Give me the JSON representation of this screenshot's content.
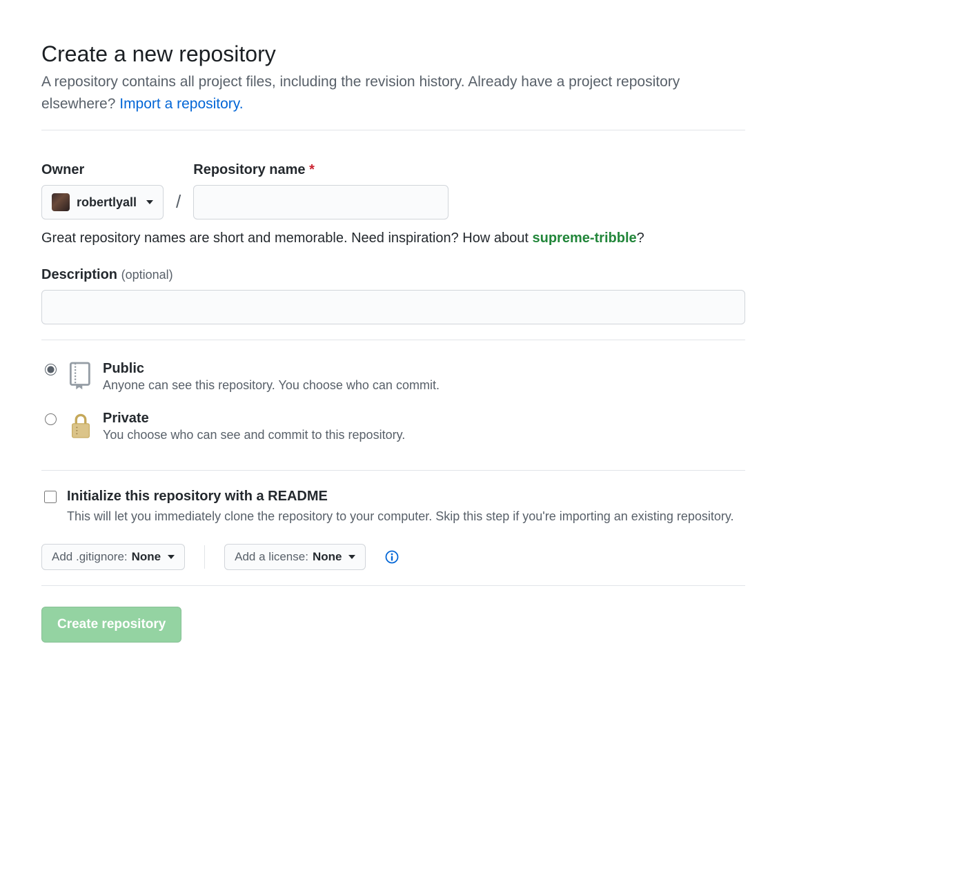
{
  "header": {
    "title": "Create a new repository",
    "subhead_text": "A repository contains all project files, including the revision history. Already have a project repository elsewhere? ",
    "import_link": "Import a repository."
  },
  "owner": {
    "label": "Owner",
    "selected": "robertlyall"
  },
  "repo_name": {
    "label": "Repository name",
    "required_marker": "*",
    "value": ""
  },
  "naming_tip": {
    "prefix": "Great repository names are short and memorable. Need inspiration? How about ",
    "suggestion": "supreme-tribble",
    "suffix": "?"
  },
  "description": {
    "label": "Description",
    "optional": "(optional)",
    "value": ""
  },
  "visibility": {
    "public": {
      "title": "Public",
      "desc": "Anyone can see this repository. You choose who can commit.",
      "checked": true
    },
    "private": {
      "title": "Private",
      "desc": "You choose who can see and commit to this repository.",
      "checked": false
    }
  },
  "init_readme": {
    "title": "Initialize this repository with a README",
    "desc": "This will let you immediately clone the repository to your computer. Skip this step if you're importing an existing repository.",
    "checked": false
  },
  "gitignore": {
    "label_prefix": "Add .gitignore: ",
    "value": "None"
  },
  "license": {
    "label_prefix": "Add a license: ",
    "value": "None"
  },
  "submit": {
    "label": "Create repository"
  }
}
